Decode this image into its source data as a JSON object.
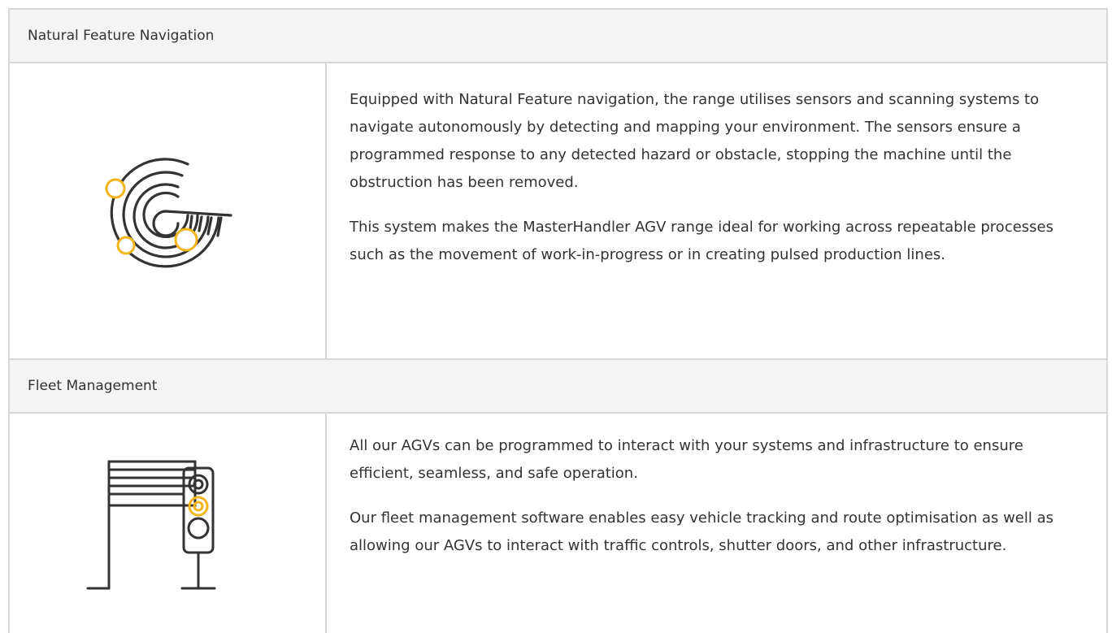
{
  "sections": [
    {
      "title": "Natural Feature Navigation",
      "icon": "radar-scan-icon",
      "paragraphs": [
        "Equipped with Natural Feature navigation, the range utilises sensors and scanning systems to navigate autonomously by detecting and mapping your environment. The sensors ensure a programmed response to any detected hazard or obstacle, stopping the machine until the obstruction has been removed.",
        "This system makes the MasterHandler AGV range ideal for working across repeatable processes such as the movement of work-in-progress or in creating pulsed production lines."
      ]
    },
    {
      "title": "Fleet Management",
      "icon": "shutter-door-traffic-light-icon",
      "paragraphs": [
        "All our AGVs can be programmed to interact with your systems and infrastructure to ensure efficient, seamless, and safe operation.",
        "Our fleet management software enables easy vehicle tracking and route optimisation as well as allowing our AGVs to interact with traffic controls, shutter doors, and other infrastructure."
      ]
    }
  ],
  "colors": {
    "accent": "#f2b51c",
    "line": "#333333",
    "border": "#d6d6d6",
    "header_bg": "#f4f4f4"
  }
}
